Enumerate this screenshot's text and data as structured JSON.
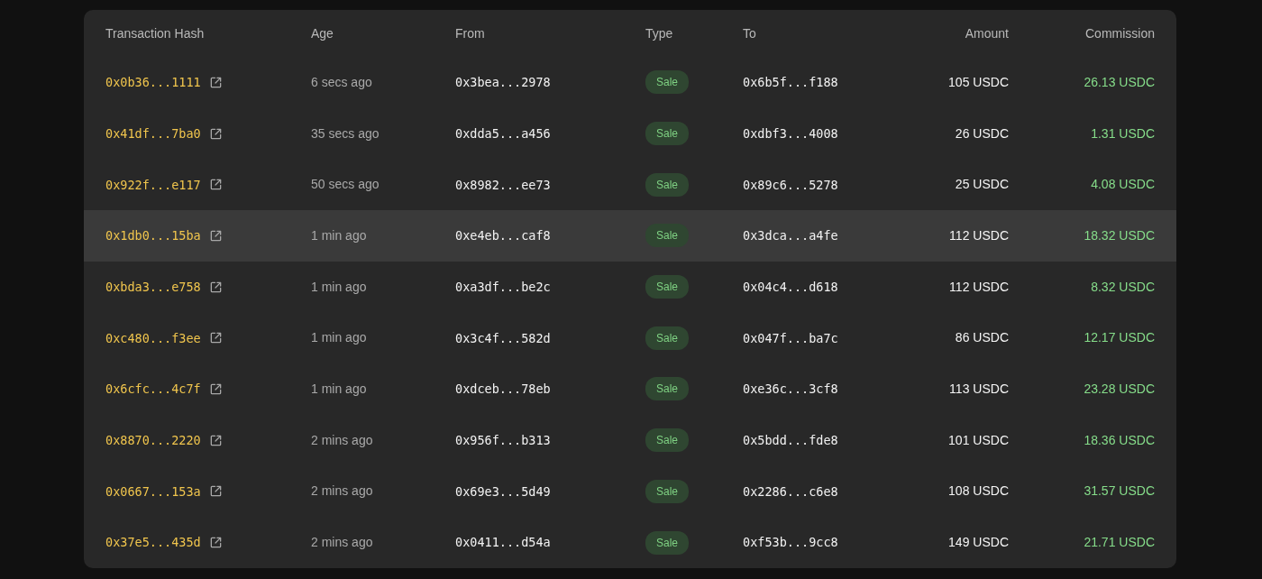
{
  "table": {
    "columns": [
      "Transaction Hash",
      "Age",
      "From",
      "Type",
      "To",
      "Amount",
      "Commission"
    ],
    "rows": [
      {
        "hash": "0x0b36...1111",
        "age": "6 secs ago",
        "from": "0x3bea...2978",
        "type": "Sale",
        "to": "0x6b5f...f188",
        "amount": "105 USDC",
        "commission": "26.13 USDC",
        "selected": false
      },
      {
        "hash": "0x41df...7ba0",
        "age": "35 secs ago",
        "from": "0xdda5...a456",
        "type": "Sale",
        "to": "0xdbf3...4008",
        "amount": "26 USDC",
        "commission": "1.31 USDC",
        "selected": false
      },
      {
        "hash": "0x922f...e117",
        "age": "50 secs ago",
        "from": "0x8982...ee73",
        "type": "Sale",
        "to": "0x89c6...5278",
        "amount": "25 USDC",
        "commission": "4.08 USDC",
        "selected": false
      },
      {
        "hash": "0x1db0...15ba",
        "age": "1 min ago",
        "from": "0xe4eb...caf8",
        "type": "Sale",
        "to": "0x3dca...a4fe",
        "amount": "112 USDC",
        "commission": "18.32 USDC",
        "selected": true
      },
      {
        "hash": "0xbda3...e758",
        "age": "1 min ago",
        "from": "0xa3df...be2c",
        "type": "Sale",
        "to": "0x04c4...d618",
        "amount": "112 USDC",
        "commission": "8.32 USDC",
        "selected": false
      },
      {
        "hash": "0xc480...f3ee",
        "age": "1 min ago",
        "from": "0x3c4f...582d",
        "type": "Sale",
        "to": "0x047f...ba7c",
        "amount": "86 USDC",
        "commission": "12.17 USDC",
        "selected": false
      },
      {
        "hash": "0x6cfc...4c7f",
        "age": "1 min ago",
        "from": "0xdceb...78eb",
        "type": "Sale",
        "to": "0xe36c...3cf8",
        "amount": "113 USDC",
        "commission": "23.28 USDC",
        "selected": false
      },
      {
        "hash": "0x8870...2220",
        "age": "2 mins ago",
        "from": "0x956f...b313",
        "type": "Sale",
        "to": "0x5bdd...fde8",
        "amount": "101 USDC",
        "commission": "18.36 USDC",
        "selected": false
      },
      {
        "hash": "0x0667...153a",
        "age": "2 mins ago",
        "from": "0x69e3...5d49",
        "type": "Sale",
        "to": "0x2286...c6e8",
        "amount": "108 USDC",
        "commission": "31.57 USDC",
        "selected": false
      },
      {
        "hash": "0x37e5...435d",
        "age": "2 mins ago",
        "from": "0x0411...d54a",
        "type": "Sale",
        "to": "0xf53b...9cc8",
        "amount": "149 USDC",
        "commission": "21.71 USDC",
        "selected": false
      }
    ]
  }
}
